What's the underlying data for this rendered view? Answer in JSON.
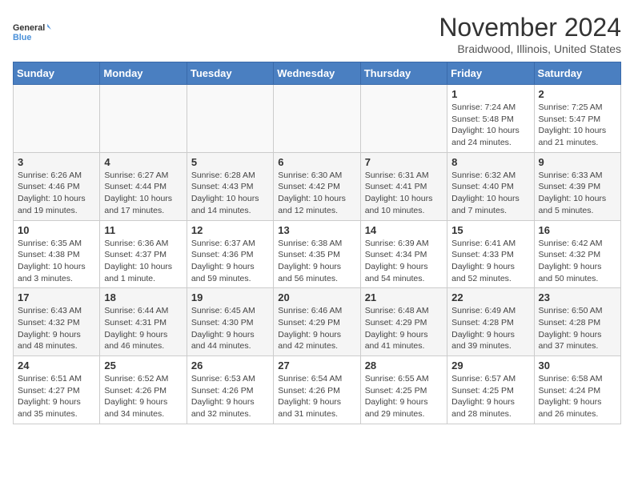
{
  "logo": {
    "general": "General",
    "blue": "Blue"
  },
  "title": "November 2024",
  "location": "Braidwood, Illinois, United States",
  "weekdays": [
    "Sunday",
    "Monday",
    "Tuesday",
    "Wednesday",
    "Thursday",
    "Friday",
    "Saturday"
  ],
  "weeks": [
    [
      {
        "day": "",
        "info": ""
      },
      {
        "day": "",
        "info": ""
      },
      {
        "day": "",
        "info": ""
      },
      {
        "day": "",
        "info": ""
      },
      {
        "day": "",
        "info": ""
      },
      {
        "day": "1",
        "info": "Sunrise: 7:24 AM\nSunset: 5:48 PM\nDaylight: 10 hours and 24 minutes."
      },
      {
        "day": "2",
        "info": "Sunrise: 7:25 AM\nSunset: 5:47 PM\nDaylight: 10 hours and 21 minutes."
      }
    ],
    [
      {
        "day": "3",
        "info": "Sunrise: 6:26 AM\nSunset: 4:46 PM\nDaylight: 10 hours and 19 minutes."
      },
      {
        "day": "4",
        "info": "Sunrise: 6:27 AM\nSunset: 4:44 PM\nDaylight: 10 hours and 17 minutes."
      },
      {
        "day": "5",
        "info": "Sunrise: 6:28 AM\nSunset: 4:43 PM\nDaylight: 10 hours and 14 minutes."
      },
      {
        "day": "6",
        "info": "Sunrise: 6:30 AM\nSunset: 4:42 PM\nDaylight: 10 hours and 12 minutes."
      },
      {
        "day": "7",
        "info": "Sunrise: 6:31 AM\nSunset: 4:41 PM\nDaylight: 10 hours and 10 minutes."
      },
      {
        "day": "8",
        "info": "Sunrise: 6:32 AM\nSunset: 4:40 PM\nDaylight: 10 hours and 7 minutes."
      },
      {
        "day": "9",
        "info": "Sunrise: 6:33 AM\nSunset: 4:39 PM\nDaylight: 10 hours and 5 minutes."
      }
    ],
    [
      {
        "day": "10",
        "info": "Sunrise: 6:35 AM\nSunset: 4:38 PM\nDaylight: 10 hours and 3 minutes."
      },
      {
        "day": "11",
        "info": "Sunrise: 6:36 AM\nSunset: 4:37 PM\nDaylight: 10 hours and 1 minute."
      },
      {
        "day": "12",
        "info": "Sunrise: 6:37 AM\nSunset: 4:36 PM\nDaylight: 9 hours and 59 minutes."
      },
      {
        "day": "13",
        "info": "Sunrise: 6:38 AM\nSunset: 4:35 PM\nDaylight: 9 hours and 56 minutes."
      },
      {
        "day": "14",
        "info": "Sunrise: 6:39 AM\nSunset: 4:34 PM\nDaylight: 9 hours and 54 minutes."
      },
      {
        "day": "15",
        "info": "Sunrise: 6:41 AM\nSunset: 4:33 PM\nDaylight: 9 hours and 52 minutes."
      },
      {
        "day": "16",
        "info": "Sunrise: 6:42 AM\nSunset: 4:32 PM\nDaylight: 9 hours and 50 minutes."
      }
    ],
    [
      {
        "day": "17",
        "info": "Sunrise: 6:43 AM\nSunset: 4:32 PM\nDaylight: 9 hours and 48 minutes."
      },
      {
        "day": "18",
        "info": "Sunrise: 6:44 AM\nSunset: 4:31 PM\nDaylight: 9 hours and 46 minutes."
      },
      {
        "day": "19",
        "info": "Sunrise: 6:45 AM\nSunset: 4:30 PM\nDaylight: 9 hours and 44 minutes."
      },
      {
        "day": "20",
        "info": "Sunrise: 6:46 AM\nSunset: 4:29 PM\nDaylight: 9 hours and 42 minutes."
      },
      {
        "day": "21",
        "info": "Sunrise: 6:48 AM\nSunset: 4:29 PM\nDaylight: 9 hours and 41 minutes."
      },
      {
        "day": "22",
        "info": "Sunrise: 6:49 AM\nSunset: 4:28 PM\nDaylight: 9 hours and 39 minutes."
      },
      {
        "day": "23",
        "info": "Sunrise: 6:50 AM\nSunset: 4:28 PM\nDaylight: 9 hours and 37 minutes."
      }
    ],
    [
      {
        "day": "24",
        "info": "Sunrise: 6:51 AM\nSunset: 4:27 PM\nDaylight: 9 hours and 35 minutes."
      },
      {
        "day": "25",
        "info": "Sunrise: 6:52 AM\nSunset: 4:26 PM\nDaylight: 9 hours and 34 minutes."
      },
      {
        "day": "26",
        "info": "Sunrise: 6:53 AM\nSunset: 4:26 PM\nDaylight: 9 hours and 32 minutes."
      },
      {
        "day": "27",
        "info": "Sunrise: 6:54 AM\nSunset: 4:26 PM\nDaylight: 9 hours and 31 minutes."
      },
      {
        "day": "28",
        "info": "Sunrise: 6:55 AM\nSunset: 4:25 PM\nDaylight: 9 hours and 29 minutes."
      },
      {
        "day": "29",
        "info": "Sunrise: 6:57 AM\nSunset: 4:25 PM\nDaylight: 9 hours and 28 minutes."
      },
      {
        "day": "30",
        "info": "Sunrise: 6:58 AM\nSunset: 4:24 PM\nDaylight: 9 hours and 26 minutes."
      }
    ]
  ]
}
